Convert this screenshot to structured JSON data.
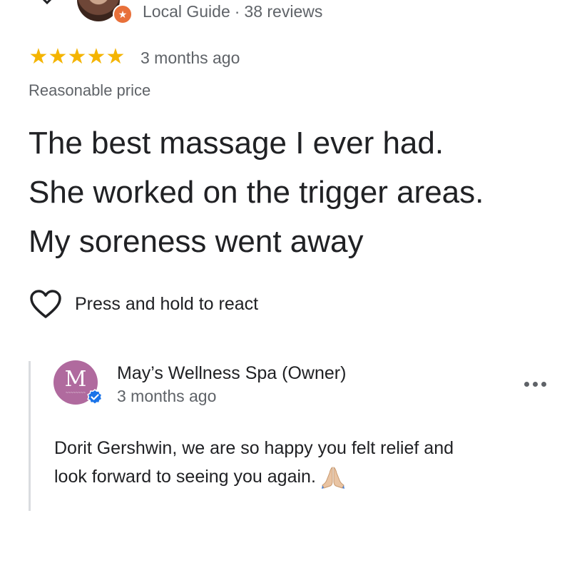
{
  "reviewer": {
    "badge_label": "Local Guide",
    "separator": "·",
    "review_count": "38 reviews"
  },
  "rating": {
    "stars": 5,
    "star_glyph": "★",
    "time_ago": "3 months ago"
  },
  "price_tag": "Reasonable price",
  "review": {
    "lines": [
      "The best massage I ever had.",
      "She worked on the trigger areas.",
      "My soreness went away"
    ]
  },
  "react": {
    "label": "Press and hold to react"
  },
  "owner_reply": {
    "logo_letter": "M",
    "name": "May’s Wellness Spa (Owner)",
    "time_ago": "3 months ago",
    "lines": [
      "Dorit Gershwin,  we are so happy you felt relief and",
      "look forward to seeing you again."
    ]
  },
  "icons": {
    "close": "close-icon",
    "more": "more-horiz-icon",
    "heart": "heart-outline-icon",
    "verified": "verified-icon",
    "local_guide": "local-guide-star-icon",
    "emoji": "folded-hands-emoji"
  },
  "colors": {
    "star": "#f4b400",
    "secondary_text": "#5f6368",
    "primary_text": "#202124",
    "verified": "#1a73e8",
    "owner_logo_bg": "#b06a9e",
    "local_guide_badge": "#e8703a"
  }
}
